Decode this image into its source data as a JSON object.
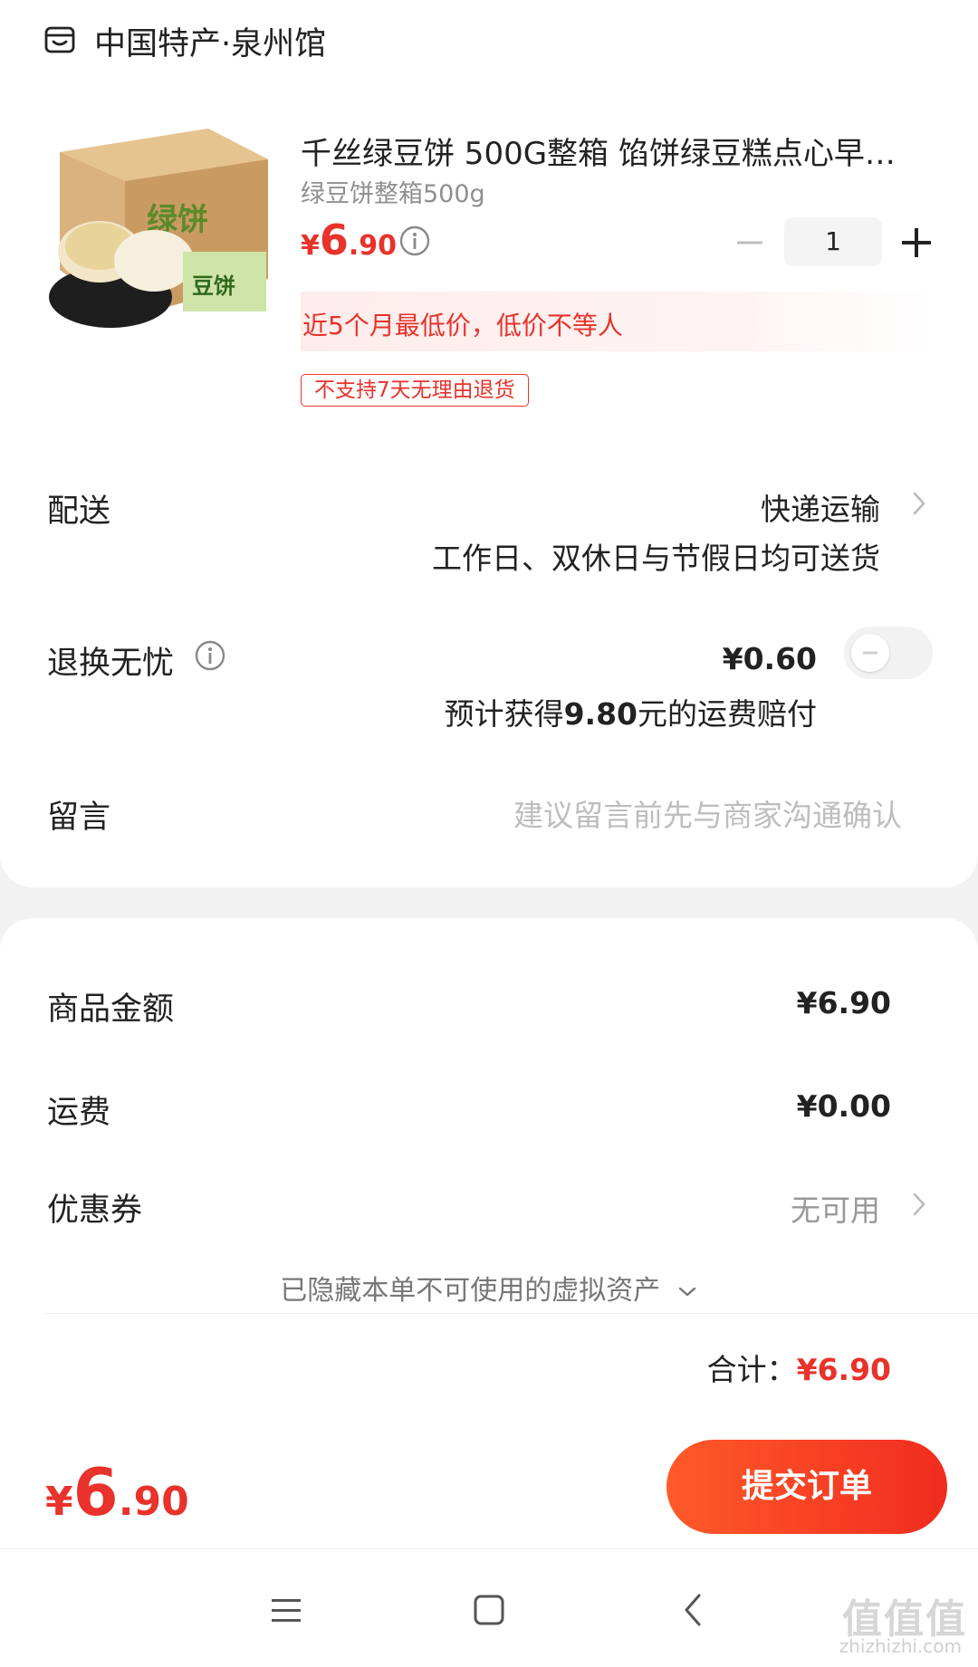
{
  "shop": {
    "name": "中国特产·泉州馆",
    "icon": "shop-icon"
  },
  "product": {
    "title": "千丝绿豆饼 500G整箱 馅饼绿豆糕点心早…",
    "spec": "绿豆饼整箱500g",
    "price": {
      "currency": "¥",
      "integer": "6",
      "decimal": ".90"
    },
    "quantity": "1",
    "low_price_text": "近5个月最低价，低价不等人",
    "tag": "不支持7天无理由退货"
  },
  "delivery": {
    "label": "配送",
    "method": "快递运输",
    "note": "工作日、双休日与节假日均可送货"
  },
  "return_service": {
    "label": "退换无忧",
    "price": "¥0.60",
    "note_prefix": "预计获得",
    "note_amount": "9.80",
    "note_suffix": "元的运费赔付",
    "toggle_on": false
  },
  "message": {
    "label": "留言",
    "placeholder": "建议留言前先与商家沟通确认"
  },
  "summary": {
    "goods_label": "商品金额",
    "goods_value": "¥6.90",
    "shipping_label": "运费",
    "shipping_value": "¥0.00",
    "coupon_label": "优惠券",
    "coupon_value": "无可用",
    "hidden_assets": "已隐藏本单不可使用的虚拟资产",
    "total_label": "合计：",
    "total_value": "¥6.90"
  },
  "bottom": {
    "price": {
      "currency": "¥",
      "integer": "6",
      "decimal": ".90"
    },
    "submit_label": "提交订单"
  },
  "watermark": {
    "main": "值值值",
    "sub": "zhizhizhi.com"
  },
  "colors": {
    "accent": "#e8322b",
    "submit_start": "#ff5a2a",
    "submit_end": "#f02c1e"
  }
}
